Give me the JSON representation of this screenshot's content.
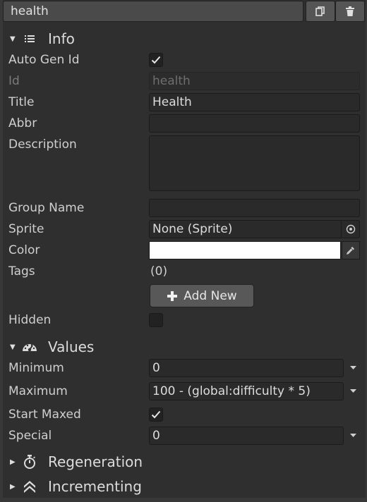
{
  "header": {
    "name_value": "health"
  },
  "info": {
    "title": "Info",
    "labels": {
      "auto_gen_id": "Auto Gen Id",
      "id": "Id",
      "title": "Title",
      "abbr": "Abbr",
      "description": "Description",
      "group_name": "Group Name",
      "sprite": "Sprite",
      "color": "Color",
      "tags": "Tags",
      "hidden": "Hidden"
    },
    "values": {
      "id": "health",
      "title": "Health",
      "abbr": "",
      "description": "",
      "group_name": "",
      "sprite": "None (Sprite)",
      "tags_count": "(0)"
    },
    "color_value": "#ffffff",
    "auto_gen_id_checked": true,
    "hidden_checked": false,
    "add_new_label": "Add New"
  },
  "values_section": {
    "title": "Values",
    "labels": {
      "minimum": "Minimum",
      "maximum": "Maximum",
      "start_maxed": "Start Maxed",
      "special": "Special"
    },
    "values": {
      "minimum": "0",
      "maximum": "100 - (global:difficulty * 5)",
      "special": "0"
    },
    "start_maxed_checked": true
  },
  "regeneration": {
    "title": "Regeneration"
  },
  "incrementing": {
    "title": "Incrementing"
  }
}
